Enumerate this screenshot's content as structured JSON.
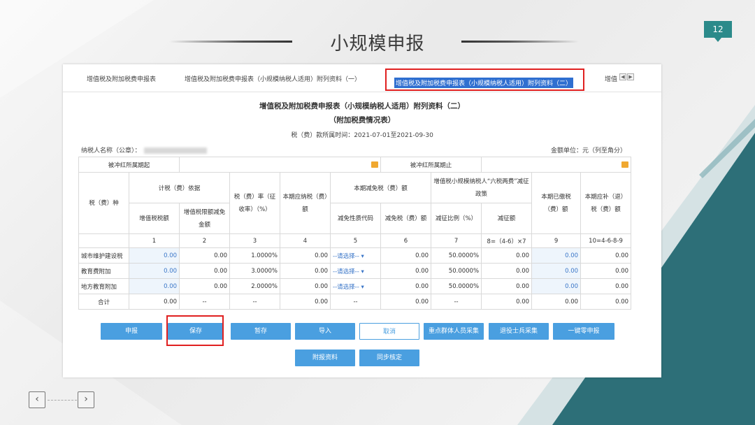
{
  "slide": {
    "title": "小规模申报",
    "page_number": "12",
    "colors": {
      "accent": "#2b8a8a",
      "highlight": "#e02020",
      "button": "#4a9fe0",
      "active_tab": "#2f6fd0"
    },
    "nav": {
      "prev_icon": "‹",
      "next_icon": "›"
    }
  },
  "tabs": [
    "增值税及附加税费申报表",
    "增值税及附加税费申报表（小规模纳税人适用）附列资料（一）",
    "增值税及附加税费申报表（小规模纳税人适用）附列资料（二）",
    "增值"
  ],
  "form": {
    "title": "增值税及附加税费申报表（小规模纳税人适用）附列资料（二）",
    "subtitle": "（附加税费情况表）",
    "period": "税（费）款所属时间：2021-07-01至2021-09-30",
    "taxpayer_label": "纳税人名称（公章）：",
    "unit": "金额单位：元（列至角分）",
    "offset_start_label": "被冲红所属期起",
    "offset_end_label": "被冲红所属期止"
  },
  "headers": {
    "tax_type": "税（费）种",
    "basis": "计税（费）依据",
    "vat_amount": "增值税税额",
    "vat_credit": "增值税限额减免金额",
    "rate": "税（费）率（征收率）（%）",
    "payable": "本期应纳税（费）额",
    "reduction": "本期减免税（费）额",
    "reduction_code": "减免性质代码",
    "reduction_amount": "减免税（费）额",
    "six_tax": "增值税小规模纳税人“六税两费”减征政策",
    "reduction_ratio": "减征比例（%）",
    "reduction_amt2": "减征额",
    "paid": "本期已缴税（费）额",
    "refund": "本期应补（退）税（费）额",
    "col_nums": [
      "1",
      "2",
      "3",
      "4",
      "5",
      "6",
      "7",
      "8=（4-6）×7",
      "9",
      "10=4-6-8-9"
    ]
  },
  "rows": [
    {
      "name": "城市维护建设税",
      "c1": "0.00",
      "c2": "0.00",
      "c3": "1.0000%",
      "c4": "0.00",
      "c5": "--请选择--",
      "c6": "0.00",
      "c7": "50.0000%",
      "c8": "0.00",
      "c9": "0.00",
      "c10": "0.00"
    },
    {
      "name": "教育费附加",
      "c1": "0.00",
      "c2": "0.00",
      "c3": "3.0000%",
      "c4": "0.00",
      "c5": "--请选择--",
      "c6": "0.00",
      "c7": "50.0000%",
      "c8": "0.00",
      "c9": "0.00",
      "c10": "0.00"
    },
    {
      "name": "地方教育附加",
      "c1": "0.00",
      "c2": "0.00",
      "c3": "2.0000%",
      "c4": "0.00",
      "c5": "--请选择--",
      "c6": "0.00",
      "c7": "50.0000%",
      "c8": "0.00",
      "c9": "0.00",
      "c10": "0.00"
    },
    {
      "name": "合计",
      "c1": "0.00",
      "c2": "--",
      "c3": "--",
      "c4": "0.00",
      "c5": "--",
      "c6": "0.00",
      "c7": "--",
      "c8": "0.00",
      "c9": "0.00",
      "c10": "0.00"
    }
  ],
  "buttons": {
    "declare": "申报",
    "save": "保存",
    "temp_save": "暂存",
    "import": "导入",
    "cancel": "取消",
    "key_group": "重点群体人员采集",
    "veteran": "退役士兵采集",
    "zero_declare": "一键零申报",
    "attachment": "附报资料",
    "sync": "同步核定"
  }
}
